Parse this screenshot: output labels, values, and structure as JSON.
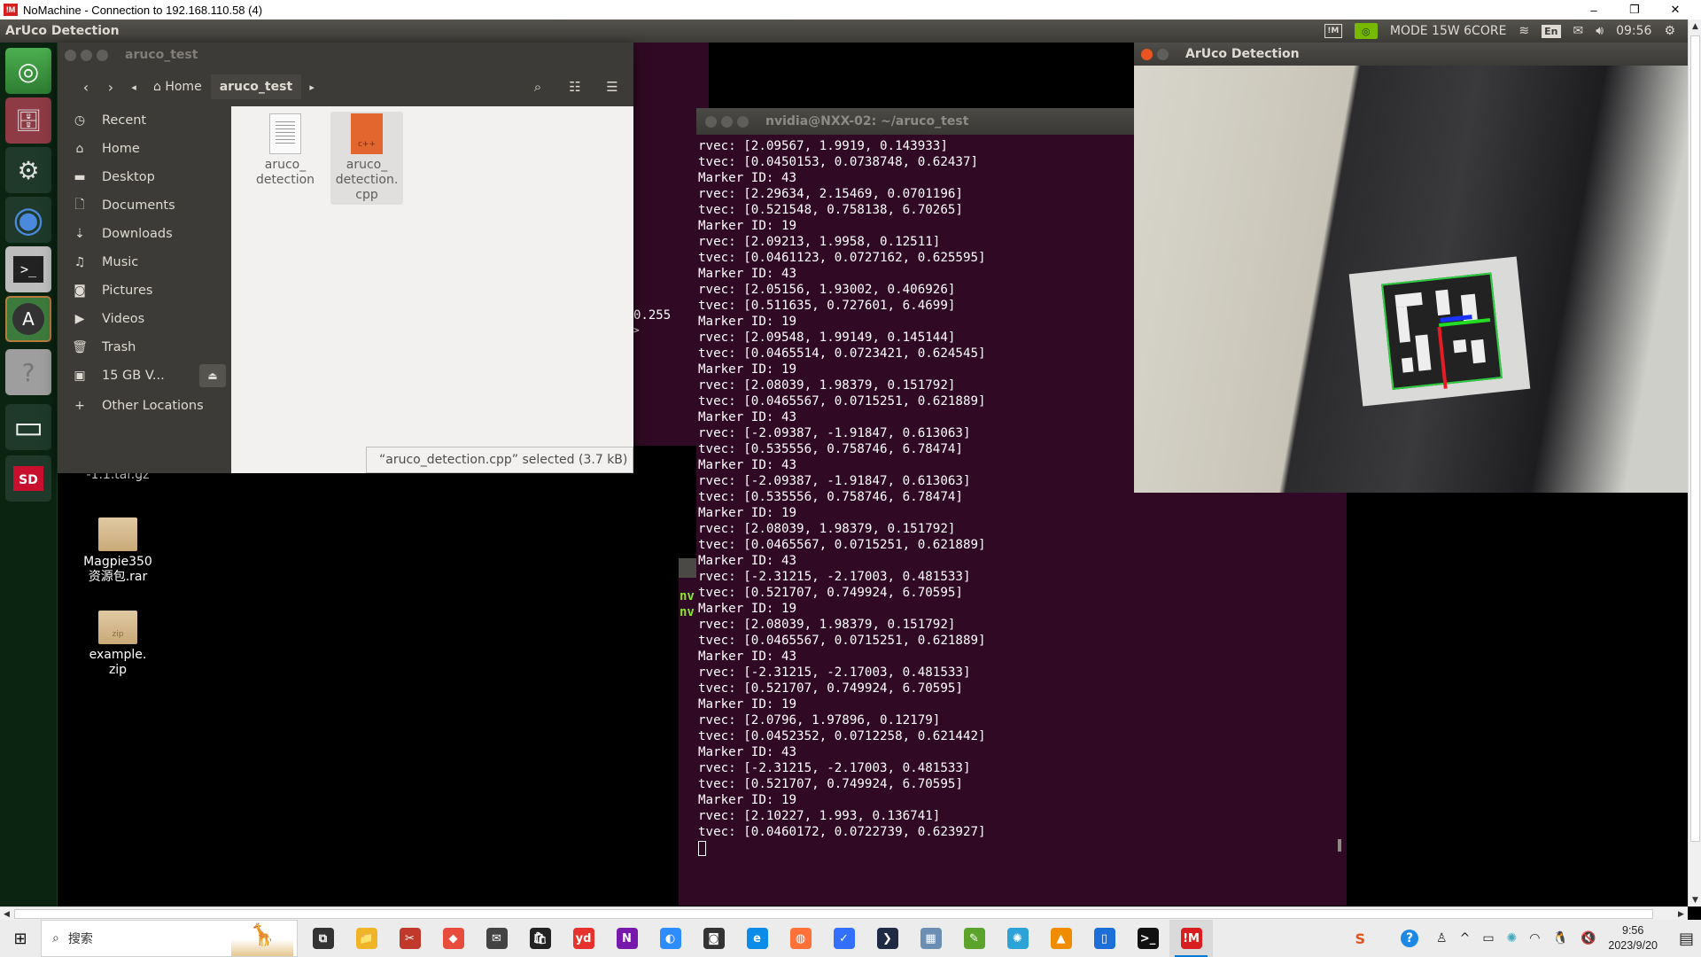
{
  "host_window": {
    "title": "NoMachine - Connection to 192.168.110.58 (4)",
    "icon": "nomachine-icon",
    "controls": {
      "minimize": "–",
      "maximize": "❐",
      "close": "✕"
    }
  },
  "top_panel": {
    "active_app": "ArUco Detection",
    "indicators": {
      "nomachine": "!M",
      "power_mode": "MODE 15W 6CORE",
      "keyboard": "En",
      "time": "09:56"
    }
  },
  "launcher": {
    "items": [
      {
        "name": "ubuntu-dash",
        "glyph": "◎"
      },
      {
        "name": "files",
        "glyph": "🗄"
      },
      {
        "name": "system-settings",
        "glyph": "⚙"
      },
      {
        "name": "chromium",
        "glyph": "◉"
      },
      {
        "name": "terminal",
        "glyph": ">_"
      },
      {
        "name": "software-updater",
        "glyph": "A"
      },
      {
        "name": "unknown-app",
        "glyph": "?"
      },
      {
        "name": "drive",
        "glyph": "▭"
      },
      {
        "name": "sd-card",
        "glyph": "SD"
      }
    ]
  },
  "desktop": {
    "icons": [
      {
        "label_line1": "-1.1.tar.gz",
        "label_line2": ""
      },
      {
        "label_line1": "Magpie350",
        "label_line2": "资源包.rar"
      },
      {
        "label_line1": "example.",
        "label_line2": "zip",
        "badge": "zip"
      }
    ]
  },
  "files_window": {
    "title": "aruco_test",
    "breadcrumb": {
      "home": "Home",
      "current": "aruco_test"
    },
    "sidebar": [
      {
        "label": "Recent",
        "icon": "◷"
      },
      {
        "label": "Home",
        "icon": "⌂"
      },
      {
        "label": "Desktop",
        "icon": "▬"
      },
      {
        "label": "Documents",
        "icon": "🗋"
      },
      {
        "label": "Downloads",
        "icon": "⇣"
      },
      {
        "label": "Music",
        "icon": "♫"
      },
      {
        "label": "Pictures",
        "icon": "◙"
      },
      {
        "label": "Videos",
        "icon": "▶"
      },
      {
        "label": "Trash",
        "icon": "🗑"
      },
      {
        "label": "15 GB V...",
        "icon": "▣",
        "eject": "⏏"
      },
      {
        "label": "Other Locations",
        "icon": "+"
      }
    ],
    "files": [
      {
        "line1": "aruco_",
        "line2": "detection",
        "line3": "",
        "type": "executable"
      },
      {
        "line1": "aruco_",
        "line2": "detection.",
        "line3": "cpp",
        "type": "cpp",
        "badge": "c++"
      }
    ],
    "status": "“aruco_detection.cpp” selected (3.7 kB)"
  },
  "background_terminal": {
    "fragment": "0.255",
    "fragment2": ">",
    "prompt_fragment": "nv"
  },
  "terminal": {
    "title": "nvidia@NXX-02: ~/aruco_test",
    "lines": [
      "rvec: [2.09567, 1.9919, 0.143933]",
      "tvec: [0.0450153, 0.0738748, 0.62437]",
      "Marker ID: 43",
      "rvec: [2.29634, 2.15469, 0.0701196]",
      "tvec: [0.521548, 0.758138, 6.70265]",
      "Marker ID: 19",
      "rvec: [2.09213, 1.9958, 0.12511]",
      "tvec: [0.0461123, 0.0727162, 0.625595]",
      "Marker ID: 43",
      "rvec: [2.05156, 1.93002, 0.406926]",
      "tvec: [0.511635, 0.727601, 6.4699]",
      "Marker ID: 19",
      "rvec: [2.09548, 1.99149, 0.145144]",
      "tvec: [0.0465514, 0.0723421, 0.624545]",
      "Marker ID: 19",
      "rvec: [2.08039, 1.98379, 0.151792]",
      "tvec: [0.0465567, 0.0715251, 0.621889]",
      "Marker ID: 43",
      "rvec: [-2.09387, -1.91847, 0.613063]",
      "tvec: [0.535556, 0.758746, 6.78474]",
      "Marker ID: 43",
      "rvec: [-2.09387, -1.91847, 0.613063]",
      "tvec: [0.535556, 0.758746, 6.78474]",
      "Marker ID: 19",
      "rvec: [2.08039, 1.98379, 0.151792]",
      "tvec: [0.0465567, 0.0715251, 0.621889]",
      "Marker ID: 43",
      "rvec: [-2.31215, -2.17003, 0.481533]",
      "tvec: [0.521707, 0.749924, 6.70595]",
      "Marker ID: 19",
      "rvec: [2.08039, 1.98379, 0.151792]",
      "tvec: [0.0465567, 0.0715251, 0.621889]",
      "Marker ID: 43",
      "rvec: [-2.31215, -2.17003, 0.481533]",
      "tvec: [0.521707, 0.749924, 6.70595]",
      "Marker ID: 19",
      "rvec: [2.0796, 1.97896, 0.12179]",
      "tvec: [0.0452352, 0.0712258, 0.621442]",
      "Marker ID: 43",
      "rvec: [-2.31215, -2.17003, 0.481533]",
      "tvec: [0.521707, 0.749924, 6.70595]",
      "Marker ID: 19",
      "rvec: [2.10227, 1.993, 0.136741]",
      "tvec: [0.0460172, 0.0722739, 0.623927]"
    ]
  },
  "aruco_window": {
    "title": "ArUco Detection",
    "marker_border_color": "#2ecc40",
    "axis_colors": {
      "x": "#e51c23",
      "y": "#22dd22",
      "z": "#1a33ff"
    }
  },
  "taskbar": {
    "search_placeholder": "搜索",
    "apps": [
      {
        "name": "task-view",
        "glyph": "⧉",
        "color": "#333"
      },
      {
        "name": "file-explorer",
        "glyph": "📁",
        "color": "#f0b429"
      },
      {
        "name": "snipping-tool",
        "glyph": "✂",
        "color": "#c0392b"
      },
      {
        "name": "xmind",
        "glyph": "◆",
        "color": "#e74c3c"
      },
      {
        "name": "mail",
        "glyph": "✉",
        "color": "#444"
      },
      {
        "name": "store",
        "glyph": "🛍",
        "color": "#222"
      },
      {
        "name": "youdao",
        "glyph": "yd",
        "color": "#e6312d"
      },
      {
        "name": "onenote",
        "glyph": "N",
        "color": "#7719aa"
      },
      {
        "name": "zoom",
        "glyph": "◐",
        "color": "#2d8cff"
      },
      {
        "name": "camera",
        "glyph": "◙",
        "color": "#333"
      },
      {
        "name": "edge",
        "glyph": "e",
        "color": "#0c8ce9"
      },
      {
        "name": "firefox",
        "glyph": "◍",
        "color": "#ff7139"
      },
      {
        "name": "feishu",
        "glyph": "✓",
        "color": "#3370ff"
      },
      {
        "name": "powershell",
        "glyph": "❯",
        "color": "#1f2a44"
      },
      {
        "name": "image-viewer",
        "glyph": "▦",
        "color": "#6a8fb3"
      },
      {
        "name": "notepad-plus",
        "glyph": "✎",
        "color": "#5ba32b"
      },
      {
        "name": "network-app",
        "glyph": "✺",
        "color": "#2ba3d6"
      },
      {
        "name": "vlc",
        "glyph": "▲",
        "color": "#f08c00"
      },
      {
        "name": "phone-app",
        "glyph": "▯",
        "color": "#1d6fd8"
      },
      {
        "name": "terminal",
        "glyph": ">_",
        "color": "#111"
      },
      {
        "name": "nomachine",
        "glyph": "!M",
        "color": "#d81e1e"
      }
    ],
    "tray": {
      "sogou": "S",
      "help": "?",
      "people": "♙",
      "chevron": "^",
      "battery": "▭",
      "wifi": "◠",
      "qq": "🐧",
      "volume": "🔇",
      "time": "9:56",
      "date": "2023/9/20",
      "notifications": "▤"
    }
  }
}
